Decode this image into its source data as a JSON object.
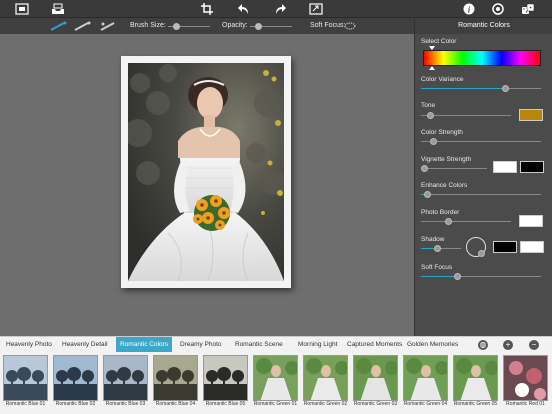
{
  "toolbar": {
    "icons": [
      "frame-icon",
      "tray-icon",
      "crop-icon",
      "undo-icon",
      "redo-icon",
      "export-icon",
      "info-icon",
      "settings-icon",
      "dice-icon"
    ]
  },
  "subbar": {
    "brush_size_label": "Brush Size:",
    "brush_size_value": 0.2,
    "opacity_label": "Opacity:",
    "opacity_value": 0.2,
    "soft_focus_label": "Soft Focus:"
  },
  "panel": {
    "title": "Romantic Colors",
    "select_color_label": "Select Color",
    "color_variance_label": "Color Variance",
    "color_variance_value": 0.7,
    "tone_label": "Tone",
    "tone_value": 0.1,
    "tone_color": "#b8860b",
    "color_strength_label": "Color Strength",
    "color_strength_value": 0.1,
    "vignette_strength_label": "Vignette Strength",
    "vignette_strength_value": 0.05,
    "vignette_colors": [
      "#ffffff",
      "#000000"
    ],
    "enhance_colors_label": "Enhance Colors",
    "enhance_colors_value": 0.05,
    "photo_border_label": "Photo Border",
    "photo_border_value": 0.3,
    "photo_border_color": "#ffffff",
    "shadow_label": "Shadow",
    "shadow_value": 0.4,
    "shadow_colors": [
      "#000000",
      "#ffffff"
    ],
    "soft_focus_label": "Soft Focus",
    "soft_focus_value": 0.3
  },
  "tabs": [
    {
      "label": "Heavenly Photo",
      "active": false
    },
    {
      "label": "Heavenly Detail",
      "active": false
    },
    {
      "label": "Romantic Colors",
      "active": true
    },
    {
      "label": "Dreamy Photo",
      "active": false
    },
    {
      "label": "Romantic Scene",
      "active": false
    },
    {
      "label": "Morning Light",
      "active": false
    },
    {
      "label": "Captured Moments",
      "active": false
    },
    {
      "label": "Golden Memories",
      "active": false
    }
  ],
  "thumbnails": [
    {
      "label": "Romantic Blue 01"
    },
    {
      "label": "Romantic Blue 02"
    },
    {
      "label": "Romantic Blue 03"
    },
    {
      "label": "Romantic Blue 04"
    },
    {
      "label": "Romantic Blue 05"
    },
    {
      "label": "Romantic Green 01"
    },
    {
      "label": "Romantic Green 02"
    },
    {
      "label": "Romantic Green 03"
    },
    {
      "label": "Romantic Green 04"
    },
    {
      "label": "Romantic Green 05"
    },
    {
      "label": "Romantic Red 01"
    }
  ],
  "accent_color": "#3ba8c9"
}
